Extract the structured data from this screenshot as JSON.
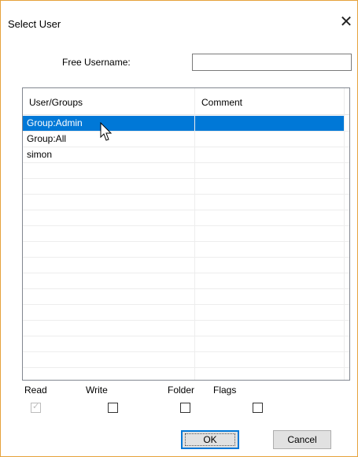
{
  "dialog": {
    "title": "Select User",
    "close_icon": "close-icon"
  },
  "free_username": {
    "label": "Free Username:",
    "value": ""
  },
  "list": {
    "columns": [
      "User/Groups",
      "Comment"
    ],
    "rows": [
      {
        "user": "Group:Admin",
        "comment": "",
        "selected": true
      },
      {
        "user": "Group:All",
        "comment": "",
        "selected": false
      },
      {
        "user": "simon",
        "comment": "",
        "selected": false
      }
    ],
    "selection_color": "#0078d7"
  },
  "permissions": {
    "read": {
      "label": "Read",
      "checked": true,
      "enabled": false
    },
    "write": {
      "label": "Write",
      "checked": false,
      "enabled": true
    },
    "folder": {
      "label": "Folder",
      "checked": false,
      "enabled": true
    },
    "flags": {
      "label": "Flags",
      "checked": false,
      "enabled": true
    }
  },
  "buttons": {
    "ok": "OK",
    "cancel": "Cancel"
  },
  "cursor_icon": "mouse-pointer-icon"
}
